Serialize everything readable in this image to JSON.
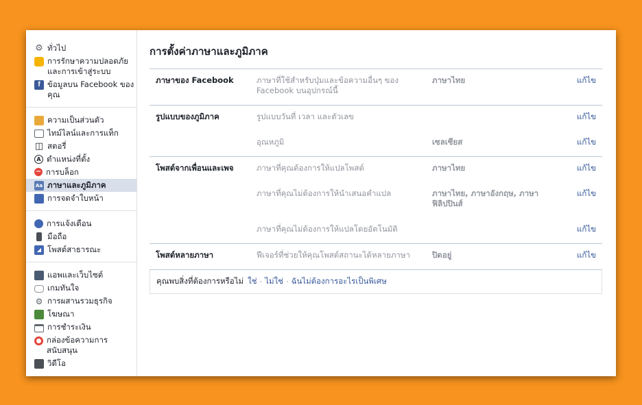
{
  "sidebar": {
    "groups": [
      [
        {
          "label": "ทั่วไป",
          "icon": "gear-icon"
        },
        {
          "label": "การรักษาความปลอดภัยและการเข้าสู่ระบบ",
          "icon": "shield-icon"
        },
        {
          "label": "ข้อมูลบน Facebook ของคุณ",
          "icon": "facebook-icon"
        }
      ],
      [
        {
          "label": "ความเป็นส่วนตัว",
          "icon": "lock-icon"
        },
        {
          "label": "ไทม์ไลน์และการแท็ก",
          "icon": "timeline-icon"
        },
        {
          "label": "สตอรี่",
          "icon": "book-icon"
        },
        {
          "label": "ตำแหน่งที่ตั้ง",
          "icon": "location-icon"
        },
        {
          "label": "การบล็อก",
          "icon": "block-icon"
        },
        {
          "label": "ภาษาและภูมิภาค",
          "icon": "language-icon"
        },
        {
          "label": "การจดจำใบหน้า",
          "icon": "face-icon"
        }
      ],
      [
        {
          "label": "การแจ้งเตือน",
          "icon": "globe-icon"
        },
        {
          "label": "มือถือ",
          "icon": "mobile-icon"
        },
        {
          "label": "โพสต์สาธารณะ",
          "icon": "rss-icon"
        }
      ],
      [
        {
          "label": "แอพและเว็บไซต์",
          "icon": "apps-icon"
        },
        {
          "label": "เกมทันใจ",
          "icon": "gamepad-icon"
        },
        {
          "label": "การผสานรวมธุรกิจ",
          "icon": "business-icon"
        },
        {
          "label": "โฆษณา",
          "icon": "ads-icon"
        },
        {
          "label": "การชำระเงิน",
          "icon": "card-icon"
        },
        {
          "label": "กล่องข้อความการสนับสนุน",
          "icon": "lifebuoy-icon"
        },
        {
          "label": "วิดีโอ",
          "icon": "video-icon"
        }
      ]
    ]
  },
  "main": {
    "title": "การตั้งค่าภาษาและภูมิภาค",
    "edit_label": "แก้ไข",
    "sections": [
      {
        "label": "ภาษาของ Facebook",
        "rows": [
          {
            "desc": "ภาษาที่ใช้สำหรับปุ่มและข้อความอื่นๆ ของ Facebook บนอุปกรณ์นี้",
            "value": "ภาษาไทย"
          }
        ]
      },
      {
        "label": "รูปแบบของภูมิภาค",
        "rows": [
          {
            "desc": "รูปแบบวันที่ เวลา และตัวเลข",
            "value": ""
          },
          {
            "desc": "อุณหภูมิ",
            "value": "เซลเซียส"
          }
        ]
      },
      {
        "label": "โพสต์จากเพื่อนและเพจ",
        "rows": [
          {
            "desc": "ภาษาที่คุณต้องการให้แปลโพสต์",
            "value": "ภาษาไทย"
          },
          {
            "desc": "ภาษาที่คุณไม่ต้องการให้นำเสนอคำแปล",
            "value": "ภาษาไทย, ภาษาอังกฤษ, ภาษาฟิลิปปินส์"
          },
          {
            "desc": "ภาษาที่คุณไม่ต้องการให้แปลโดยอัตโนมัติ",
            "value": ""
          }
        ]
      },
      {
        "label": "โพสต์หลายภาษา",
        "rows": [
          {
            "desc": "ฟีเจอร์ที่ช่วยให้คุณโพสต์สถานะได้หลายภาษา",
            "value": "ปิดอยู่"
          }
        ]
      }
    ],
    "feedback": {
      "question": "คุณพบสิ่งที่ต้องการหรือไม่",
      "yes": "ใช่",
      "no": "ไม่ใช่",
      "no_need": "ฉันไม่ต้องการอะไรเป็นพิเศษ",
      "separator": "·"
    }
  },
  "colors": {
    "accent": "#365899",
    "page_bg": "#f7931e",
    "active_bg": "#d8dfea"
  }
}
